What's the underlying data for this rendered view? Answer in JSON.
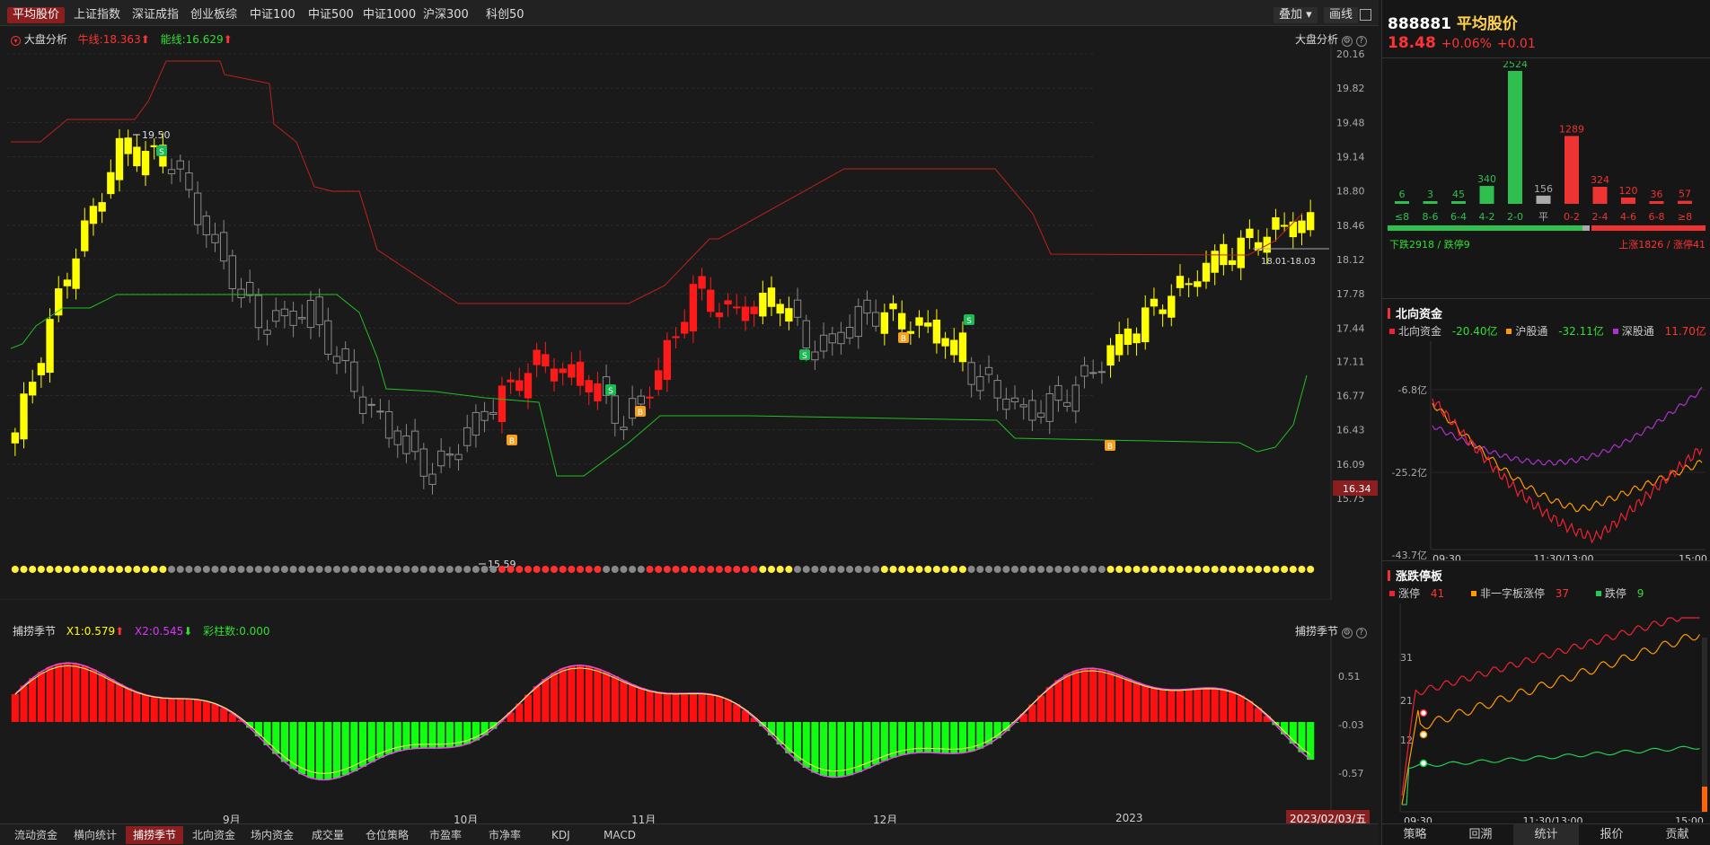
{
  "tabs": [
    "平均股价",
    "上证指数",
    "深证成指",
    "创业板综",
    "中证100",
    "中证500",
    "中证1000",
    "沪深300",
    "科创50"
  ],
  "toolbar": {
    "overlay": "叠加",
    "draw": "画线"
  },
  "main_panel": {
    "name": "大盘分析",
    "cow_label": "牛线:18.363",
    "energy_label": "能线:16.629",
    "right_label": "大盘分析"
  },
  "price_axis": [
    "20.16",
    "19.82",
    "19.48",
    "19.14",
    "18.80",
    "18.46",
    "18.12",
    "17.78",
    "17.44",
    "17.11",
    "16.77",
    "16.43",
    "16.09",
    "15.75"
  ],
  "current_price_tag": "16.34",
  "annotations": {
    "high": "19.50",
    "low": "15.59",
    "range": "18.01-18.03"
  },
  "indicator": {
    "name": "捕捞季节",
    "x1": "X1:0.579",
    "x2": "X2:0.545",
    "bars": "彩柱数:0.000",
    "right_label": "捕捞季节",
    "axis": [
      "0.51",
      "-0.03",
      "-0.57"
    ]
  },
  "time_axis": [
    "9月",
    "10月",
    "11月",
    "12月",
    "2023"
  ],
  "date_tag": "2023/02/03/五",
  "bottom_tabs": [
    "流动资金",
    "横向统计",
    "捕捞季节",
    "北向资金",
    "场内资金",
    "成交量",
    "仓位策略",
    "市盈率",
    "市净率",
    "KDJ",
    "MACD"
  ],
  "quote": {
    "code": "888881",
    "name": "平均股价",
    "price": "18.48",
    "change_pct": "+0.06%",
    "change": "+0.01"
  },
  "distribution": {
    "bins": [
      "≤8",
      "8-6",
      "6-4",
      "4-2",
      "2-0",
      "平",
      "0-2",
      "2-4",
      "4-6",
      "6-8",
      "≥8"
    ],
    "counts": [
      6,
      3,
      45,
      340,
      2524,
      156,
      1289,
      324,
      120,
      36,
      57
    ],
    "down_label": "下跌2918 / 跌停9",
    "up_label": "上涨1826 / 涨停41",
    "down_ratio": 0.613
  },
  "northbound": {
    "title": "北向资金",
    "items": [
      {
        "label": "北向资金",
        "value": "-20.40亿",
        "color": "#e23"
      },
      {
        "label": "沪股通",
        "value": "-32.11亿",
        "color": "#f90"
      },
      {
        "label": "深股通",
        "value": "11.70亿",
        "color": "#a3c"
      }
    ],
    "axis": [
      "-6.8亿",
      "-25.2亿",
      "-43.7亿"
    ],
    "times": [
      "09:30",
      "11:30/13:00",
      "15:00"
    ]
  },
  "limit": {
    "title": "涨跌停板",
    "items": [
      {
        "label": "涨停",
        "value": "41",
        "color": "#e23"
      },
      {
        "label": "非一字板涨停",
        "value": "37",
        "color": "#f90"
      },
      {
        "label": "跌停",
        "value": "9",
        "color": "#2c5"
      }
    ],
    "axis": [
      "31",
      "21",
      "12"
    ],
    "times": [
      "09:30",
      "11:30/13:00",
      "15:00"
    ]
  },
  "right_tabs": [
    "策略",
    "回溯",
    "统计",
    "报价",
    "贡献"
  ],
  "colors": {
    "up": "#ff1a1a",
    "down": "#00e600",
    "yellow": "#ffff00",
    "hollow": "#888888"
  }
}
